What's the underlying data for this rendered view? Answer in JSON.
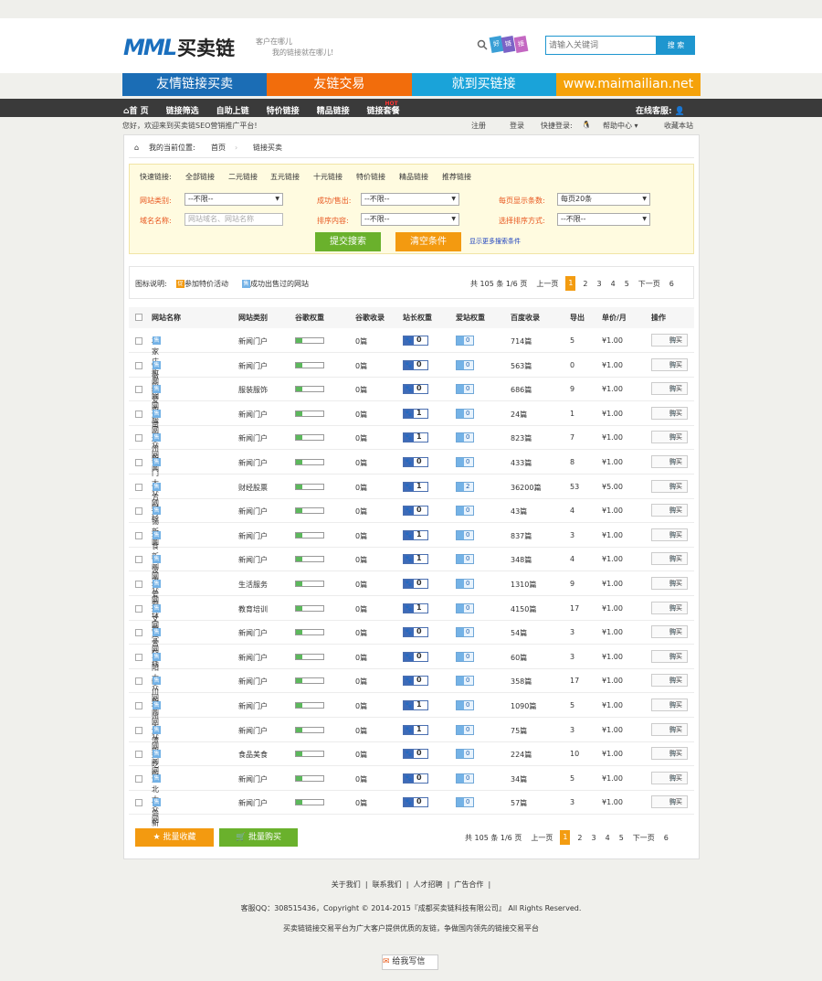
{
  "header": {
    "logo_mark": "MML",
    "logo_text": "买卖链",
    "slogan_1": "客户在哪儿",
    "slogan_2": "我的链接就在哪儿!",
    "ribbon": [
      "好",
      "链",
      "接"
    ],
    "search_placeholder": "请输入关键词",
    "search_button": "搜 索"
  },
  "banner": [
    {
      "label": "友情链接买卖",
      "color": "#1b6db5"
    },
    {
      "label": "友链交易",
      "color": "#f26d0c"
    },
    {
      "label": "就到买链接",
      "color": "#1aa3d9"
    },
    {
      "label": "www.maimailian.net",
      "color": "#f5a20a"
    }
  ],
  "nav": {
    "items": [
      "首 页",
      "链接筛选",
      "自助上链",
      "特价链接",
      "精品链接",
      "链接套餐"
    ],
    "hot": "HOT",
    "customer_service": "在线客服:"
  },
  "infobar": {
    "welcome": "您好，欢迎来到买卖链SEO营销推广平台!",
    "register": "注册",
    "login": "登录",
    "quick_login": "快捷登录:",
    "help": "帮助中心",
    "bookmark": "收藏本站"
  },
  "breadcrumb": {
    "label": "我的当前位置:",
    "home": "首页",
    "current": "链接买卖"
  },
  "filter": {
    "quick_label": "快速链接:",
    "quick_links": [
      "全部链接",
      "二元链接",
      "五元链接",
      "十元链接",
      "特价链接",
      "精品链接",
      "推荐链接"
    ],
    "site_type_label": "网站类别:",
    "site_type_value": "--不限--",
    "sold_label": "成功/售出:",
    "sold_value": "--不限--",
    "per_page_label": "每页显示条数:",
    "per_page_value": "每页20条",
    "domain_label": "域名名称:",
    "domain_placeholder": "网站域名、网站名称",
    "sort_content_label": "排序内容:",
    "sort_content_value": "--不限--",
    "sort_method_label": "选择排序方式:",
    "sort_method_value": "--不限--",
    "submit": "提交搜索",
    "clear": "清空条件",
    "more": "显示更多搜索条件"
  },
  "legend": {
    "label": "图标说明:",
    "discount_icon": "促",
    "discount_text": "参加特价活动",
    "sold_icon": "售",
    "sold_text": "成功出售过的网站"
  },
  "pagination": {
    "summary": "共 105 条 1/6 页",
    "prev": "上一页",
    "pages": [
      "1",
      "2",
      "3",
      "4",
      "5"
    ],
    "next": "下一页",
    "last": "6"
  },
  "table": {
    "headers": [
      "网站名称",
      "网站类别",
      "谷歌权重",
      "谷歌收录",
      "站长权重",
      "爱站权重",
      "百度收录",
      "导出",
      "单价/月",
      "操作"
    ],
    "buy_label": "购买",
    "rows": [
      {
        "name": "石家庄新闻网",
        "type": "新闻门户",
        "google": "0篇",
        "zz": "0",
        "az": "0",
        "baidu": "714篇",
        "out": "5",
        "price": "¥1.00"
      },
      {
        "name": "安徽新闻网",
        "type": "新闻门户",
        "google": "0篇",
        "zz": "0",
        "az": "0",
        "baidu": "563篇",
        "out": "0",
        "price": "¥1.00"
      },
      {
        "name": "我爱衣服网",
        "type": "服装服饰",
        "google": "0篇",
        "zz": "0",
        "az": "0",
        "baidu": "686篇",
        "out": "9",
        "price": "¥1.00"
      },
      {
        "name": "淮南大众网",
        "type": "新闻门户",
        "google": "0篇",
        "zz": "1",
        "az": "0",
        "baidu": "24篇",
        "out": "1",
        "price": "¥1.00"
      },
      {
        "name": "广州新闻",
        "type": "新闻门户",
        "google": "0篇",
        "zz": "1",
        "az": "0",
        "baidu": "823篇",
        "out": "7",
        "price": "¥1.00"
      },
      {
        "name": "江门大众网",
        "type": "新闻门户",
        "google": "0篇",
        "zz": "0",
        "az": "0",
        "baidu": "433篇",
        "out": "8",
        "price": "¥1.00"
      },
      {
        "name": "东方财经",
        "type": "财经股票",
        "google": "0篇",
        "zz": "1",
        "az": "2",
        "baidu": "36200篇",
        "out": "53",
        "price": "¥5.00"
      },
      {
        "name": "无锡新闻",
        "type": "新闻门户",
        "google": "0篇",
        "zz": "0",
        "az": "0",
        "baidu": "43篇",
        "out": "4",
        "price": "¥1.00"
      },
      {
        "name": "美食新闻网",
        "type": "新闻门户",
        "google": "0篇",
        "zz": "1",
        "az": "0",
        "baidu": "837篇",
        "out": "3",
        "price": "¥1.00"
      },
      {
        "name": "宁波大众网",
        "type": "新闻门户",
        "google": "0篇",
        "zz": "1",
        "az": "0",
        "baidu": "348篇",
        "out": "4",
        "price": "¥1.00"
      },
      {
        "name": "我爱看球网",
        "type": "生活服务",
        "google": "0篇",
        "zz": "0",
        "az": "0",
        "baidu": "1310篇",
        "out": "9",
        "price": "¥1.00"
      },
      {
        "name": "作文教学网",
        "type": "教育培训",
        "google": "0篇",
        "zz": "1",
        "az": "0",
        "baidu": "4150篇",
        "out": "17",
        "price": "¥1.00"
      },
      {
        "name": "东营在线",
        "type": "新闻门户",
        "google": "0篇",
        "zz": "0",
        "az": "0",
        "baidu": "54篇",
        "out": "3",
        "price": "¥1.00"
      },
      {
        "name": "岳阳大众网",
        "type": "新闻门户",
        "google": "0篇",
        "zz": "0",
        "az": "0",
        "baidu": "60篇",
        "out": "3",
        "price": "¥1.00"
      },
      {
        "name": "四川新闻网",
        "type": "新闻门户",
        "google": "0篇",
        "zz": "0",
        "az": "0",
        "baidu": "358篇",
        "out": "17",
        "price": "¥1.00"
      },
      {
        "name": "徐州大众网",
        "type": "新闻门户",
        "google": "0篇",
        "zz": "1",
        "az": "0",
        "baidu": "1090篇",
        "out": "5",
        "price": "¥1.00"
      },
      {
        "name": "湘潭新闻网",
        "type": "新闻门户",
        "google": "0篇",
        "zz": "1",
        "az": "0",
        "baidu": "75篇",
        "out": "3",
        "price": "¥1.00"
      },
      {
        "name": "好吃街",
        "type": "食品美食",
        "google": "0篇",
        "zz": "0",
        "az": "0",
        "baidu": "224篇",
        "out": "10",
        "price": "¥1.00"
      },
      {
        "name": "淮北大众网",
        "type": "新闻门户",
        "google": "0篇",
        "zz": "0",
        "az": "0",
        "baidu": "34篇",
        "out": "5",
        "price": "¥1.00"
      },
      {
        "name": "青岛新闻",
        "type": "新闻门户",
        "google": "0篇",
        "zz": "0",
        "az": "0",
        "baidu": "57篇",
        "out": "3",
        "price": "¥1.00"
      }
    ]
  },
  "actions": {
    "batch_fav": "批量收藏",
    "batch_buy": "批量购买"
  },
  "footer": {
    "links": [
      "关于我们",
      "联系我们",
      "人才招聘",
      "广告合作"
    ],
    "copyright": "客服QQ：308515436，Copyright © 2014-2015『成都买卖链科技有限公司』 All Rights Reserved.",
    "description": "买卖链链接交易平台为广大客户提供优质的友链，争做国内领先的链接交易平台",
    "mail": "给我写信"
  }
}
